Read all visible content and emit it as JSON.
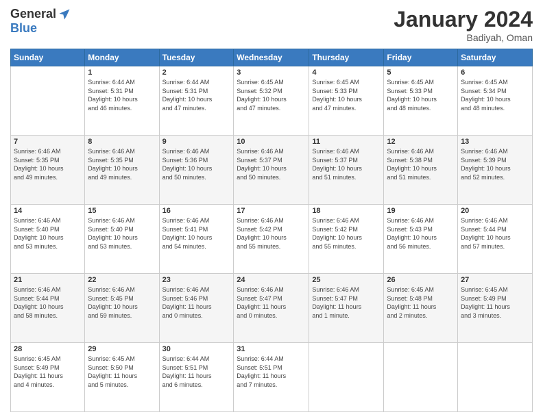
{
  "logo": {
    "general": "General",
    "blue": "Blue"
  },
  "header": {
    "month": "January 2024",
    "location": "Badiyah, Oman"
  },
  "days_of_week": [
    "Sunday",
    "Monday",
    "Tuesday",
    "Wednesday",
    "Thursday",
    "Friday",
    "Saturday"
  ],
  "weeks": [
    [
      {
        "day": "",
        "sunrise": "",
        "sunset": "",
        "daylight": ""
      },
      {
        "day": "1",
        "sunrise": "6:44 AM",
        "sunset": "5:31 PM",
        "daylight": "10 hours and 46 minutes."
      },
      {
        "day": "2",
        "sunrise": "6:44 AM",
        "sunset": "5:31 PM",
        "daylight": "10 hours and 47 minutes."
      },
      {
        "day": "3",
        "sunrise": "6:45 AM",
        "sunset": "5:32 PM",
        "daylight": "10 hours and 47 minutes."
      },
      {
        "day": "4",
        "sunrise": "6:45 AM",
        "sunset": "5:33 PM",
        "daylight": "10 hours and 47 minutes."
      },
      {
        "day": "5",
        "sunrise": "6:45 AM",
        "sunset": "5:33 PM",
        "daylight": "10 hours and 48 minutes."
      },
      {
        "day": "6",
        "sunrise": "6:45 AM",
        "sunset": "5:34 PM",
        "daylight": "10 hours and 48 minutes."
      }
    ],
    [
      {
        "day": "7",
        "sunrise": "6:46 AM",
        "sunset": "5:35 PM",
        "daylight": "10 hours and 49 minutes."
      },
      {
        "day": "8",
        "sunrise": "6:46 AM",
        "sunset": "5:35 PM",
        "daylight": "10 hours and 49 minutes."
      },
      {
        "day": "9",
        "sunrise": "6:46 AM",
        "sunset": "5:36 PM",
        "daylight": "10 hours and 50 minutes."
      },
      {
        "day": "10",
        "sunrise": "6:46 AM",
        "sunset": "5:37 PM",
        "daylight": "10 hours and 50 minutes."
      },
      {
        "day": "11",
        "sunrise": "6:46 AM",
        "sunset": "5:37 PM",
        "daylight": "10 hours and 51 minutes."
      },
      {
        "day": "12",
        "sunrise": "6:46 AM",
        "sunset": "5:38 PM",
        "daylight": "10 hours and 51 minutes."
      },
      {
        "day": "13",
        "sunrise": "6:46 AM",
        "sunset": "5:39 PM",
        "daylight": "10 hours and 52 minutes."
      }
    ],
    [
      {
        "day": "14",
        "sunrise": "6:46 AM",
        "sunset": "5:40 PM",
        "daylight": "10 hours and 53 minutes."
      },
      {
        "day": "15",
        "sunrise": "6:46 AM",
        "sunset": "5:40 PM",
        "daylight": "10 hours and 53 minutes."
      },
      {
        "day": "16",
        "sunrise": "6:46 AM",
        "sunset": "5:41 PM",
        "daylight": "10 hours and 54 minutes."
      },
      {
        "day": "17",
        "sunrise": "6:46 AM",
        "sunset": "5:42 PM",
        "daylight": "10 hours and 55 minutes."
      },
      {
        "day": "18",
        "sunrise": "6:46 AM",
        "sunset": "5:42 PM",
        "daylight": "10 hours and 55 minutes."
      },
      {
        "day": "19",
        "sunrise": "6:46 AM",
        "sunset": "5:43 PM",
        "daylight": "10 hours and 56 minutes."
      },
      {
        "day": "20",
        "sunrise": "6:46 AM",
        "sunset": "5:44 PM",
        "daylight": "10 hours and 57 minutes."
      }
    ],
    [
      {
        "day": "21",
        "sunrise": "6:46 AM",
        "sunset": "5:44 PM",
        "daylight": "10 hours and 58 minutes."
      },
      {
        "day": "22",
        "sunrise": "6:46 AM",
        "sunset": "5:45 PM",
        "daylight": "10 hours and 59 minutes."
      },
      {
        "day": "23",
        "sunrise": "6:46 AM",
        "sunset": "5:46 PM",
        "daylight": "11 hours and 0 minutes."
      },
      {
        "day": "24",
        "sunrise": "6:46 AM",
        "sunset": "5:47 PM",
        "daylight": "11 hours and 0 minutes."
      },
      {
        "day": "25",
        "sunrise": "6:46 AM",
        "sunset": "5:47 PM",
        "daylight": "11 hours and 1 minute."
      },
      {
        "day": "26",
        "sunrise": "6:45 AM",
        "sunset": "5:48 PM",
        "daylight": "11 hours and 2 minutes."
      },
      {
        "day": "27",
        "sunrise": "6:45 AM",
        "sunset": "5:49 PM",
        "daylight": "11 hours and 3 minutes."
      }
    ],
    [
      {
        "day": "28",
        "sunrise": "6:45 AM",
        "sunset": "5:49 PM",
        "daylight": "11 hours and 4 minutes."
      },
      {
        "day": "29",
        "sunrise": "6:45 AM",
        "sunset": "5:50 PM",
        "daylight": "11 hours and 5 minutes."
      },
      {
        "day": "30",
        "sunrise": "6:44 AM",
        "sunset": "5:51 PM",
        "daylight": "11 hours and 6 minutes."
      },
      {
        "day": "31",
        "sunrise": "6:44 AM",
        "sunset": "5:51 PM",
        "daylight": "11 hours and 7 minutes."
      },
      {
        "day": "",
        "sunrise": "",
        "sunset": "",
        "daylight": ""
      },
      {
        "day": "",
        "sunrise": "",
        "sunset": "",
        "daylight": ""
      },
      {
        "day": "",
        "sunrise": "",
        "sunset": "",
        "daylight": ""
      }
    ]
  ]
}
